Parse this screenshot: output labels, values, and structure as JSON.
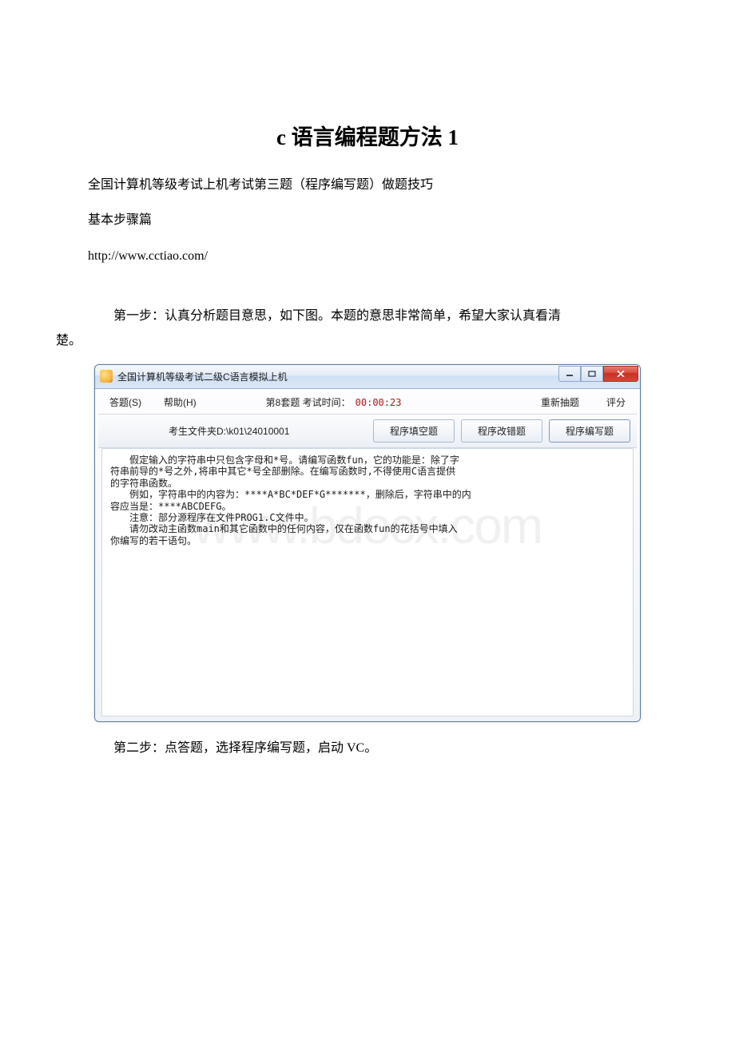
{
  "doc": {
    "title": "c 语言编程题方法 1",
    "p1": "全国计算机等级考试上机考试第三题（程序编写题）做题技巧",
    "p2": "基本步骤篇",
    "link": "http://www.cctiao.com/",
    "step1_a": "第一步：认真分析题目意思，如下图。本题的意思非常简单，希望大家认真看清",
    "step1_b": "楚。",
    "step2": "第二步：点答题，选择程序编写题，启动 VC。"
  },
  "app": {
    "title": "全国计算机等级考试二级C语言模拟上机",
    "menu": {
      "answer": "答题(S)",
      "help": "帮助(H)",
      "set_label": "第8套题 考试时间：",
      "timer": "00:00:23",
      "redraw": "重新抽题",
      "score": "评分"
    },
    "toolbar": {
      "path": "考生文件夹D:\\k01\\24010001",
      "btn_fill": "程序填空题",
      "btn_fix": "程序改错题",
      "btn_write": "程序编写题"
    },
    "content": "　　假定输入的字符串中只包含字母和*号。请编写函数fun，它的功能是：除了字\n符串前导的*号之外,将串中其它*号全部删除。在编写函数时,不得使用C语言提供\n的字符串函数。\n　　例如，字符串中的内容为：****A*BC*DEF*G*******，删除后，字符串中的内\n容应当是：****ABCDEFG。\n　　注意：部分源程序在文件PROG1.C文件中。\n　　请勿改动主函数main和其它函数中的任何内容，仅在函数fun的花括号中填入\n你编写的若干语句。",
    "watermark": "www.bdocx.com"
  }
}
